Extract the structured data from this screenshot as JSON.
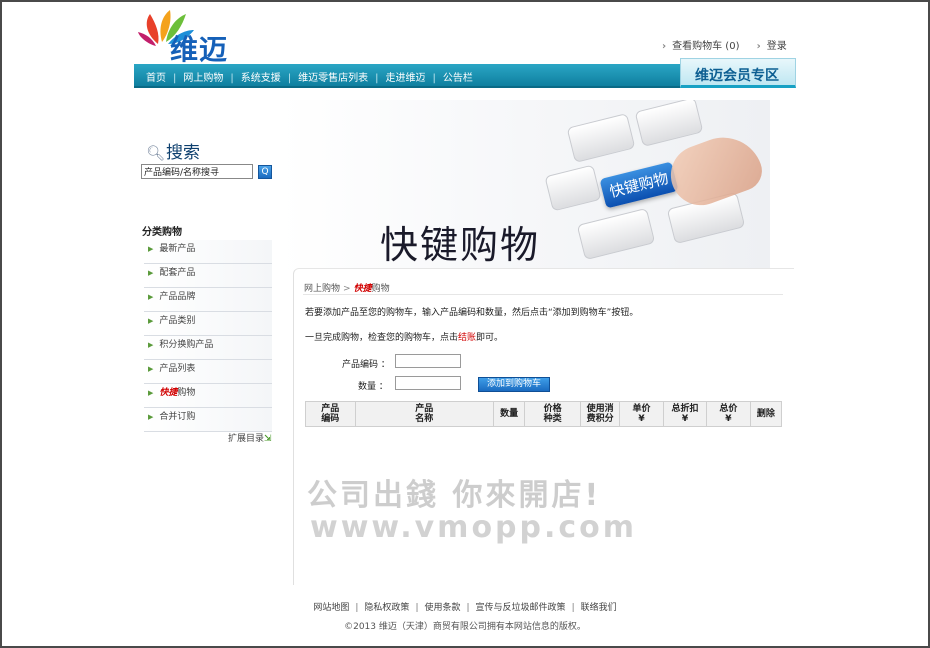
{
  "header": {
    "logo_text": "维迈",
    "cart_link": "查看购物车 (0)",
    "login_link": "登录",
    "member_zone": "维迈会员专区"
  },
  "nav": {
    "items": [
      "首页",
      "网上购物",
      "系统支援",
      "维迈零售店列表",
      "走进维迈",
      "公告栏"
    ]
  },
  "banner": {
    "title": "快键购物",
    "key_label": "快键购物"
  },
  "sidebar": {
    "search_title": "搜索",
    "search_value": "产品编码/名称搜寻",
    "search_button": "Q",
    "category_title": "分类购物",
    "categories": [
      "最新产品",
      "配套产品",
      "产品品牌",
      "产品类别",
      "积分换购产品",
      "产品列表"
    ],
    "active_category_hl": "快捷",
    "active_category_rest": "购物",
    "last_category": "合并订购",
    "expand_link": "扩展目录"
  },
  "content": {
    "breadcrumb_root": "网上购物",
    "breadcrumb_sep": ">",
    "breadcrumb_current_hl": "快捷",
    "breadcrumb_current_rest": "购物",
    "instruction1": "若要添加产品至您的购物车，输入产品编码和数量，然后点击“添加到购物车”按钮。",
    "instruction2_pre": "一旦完成购物，检查您的购物车，点击",
    "instruction2_link": "结账",
    "instruction2_post": "即可。",
    "product_code_label": "产品编码 ：",
    "quantity_label": "数量 ：",
    "add_button": "添加到购物车",
    "table_headers": [
      {
        "l1": "产品",
        "l2": "编码"
      },
      {
        "l1": "产品",
        "l2": "名称"
      },
      {
        "l1": "数量",
        "l2": ""
      },
      {
        "l1": "价格",
        "l2": "种类"
      },
      {
        "l1": "使用消",
        "l2": "费积分"
      },
      {
        "l1": "单价",
        "l2": "¥"
      },
      {
        "l1": "总折扣",
        "l2": "¥"
      },
      {
        "l1": "总价",
        "l2": "¥"
      },
      {
        "l1": "删除",
        "l2": ""
      }
    ]
  },
  "watermark": {
    "line1": "公司出錢 你來開店!",
    "line2": "www.vmopp.com"
  },
  "footer": {
    "links": [
      "网站地图",
      "隐私权政策",
      "使用条款",
      "宣传与反垃圾邮件政策",
      "联络我们"
    ],
    "copyright": "©2013 维迈（天津）商贸有限公司拥有本网站信息的版权。"
  },
  "colors": {
    "nav_bg": "#1a93b4",
    "brand_blue": "#1560b8",
    "highlight_red": "#d10000"
  }
}
